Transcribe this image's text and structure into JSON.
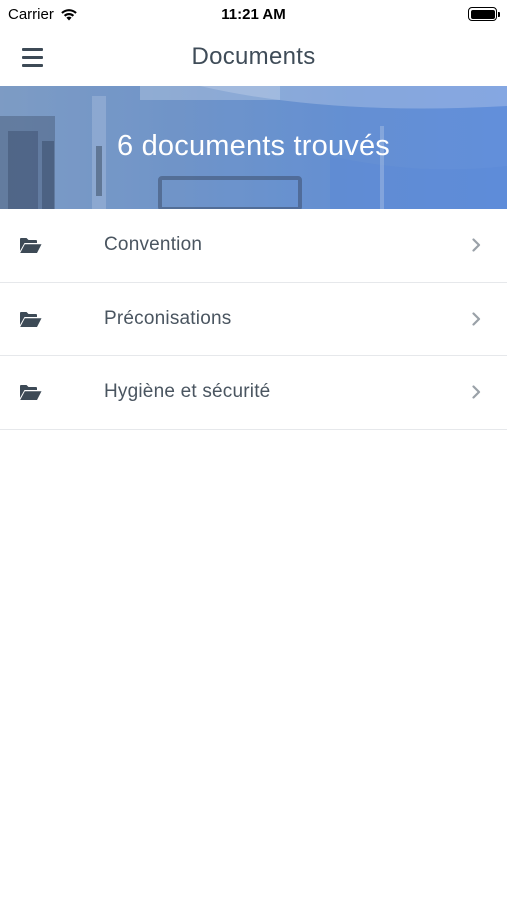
{
  "status_bar": {
    "carrier": "Carrier",
    "time": "11:21 AM",
    "wifi_icon": "wifi-icon",
    "battery_icon": "battery-icon"
  },
  "nav": {
    "title": "Documents",
    "menu_icon": "hamburger-menu-icon"
  },
  "banner": {
    "text": "6 documents trouvés"
  },
  "documents": {
    "items": [
      {
        "label": "Convention",
        "icon": "folder-open-icon"
      },
      {
        "label": "Préconisations",
        "icon": "folder-open-icon"
      },
      {
        "label": "Hygiène et sécurité",
        "icon": "folder-open-icon"
      }
    ]
  },
  "colors": {
    "text_dark": "#3f4c58",
    "banner_blue": "#6e93c9",
    "divider": "#e6e8eb"
  }
}
